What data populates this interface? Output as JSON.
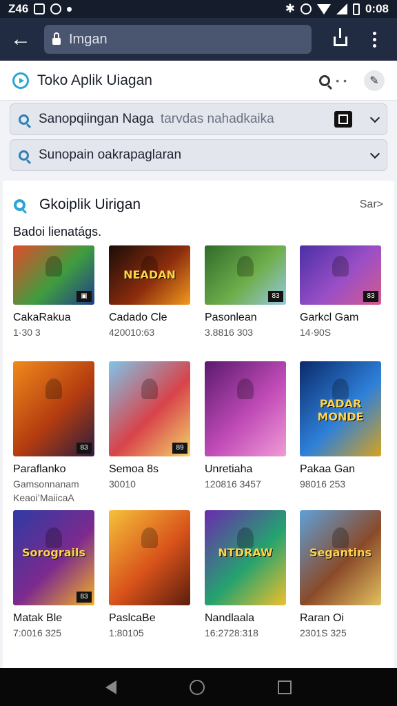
{
  "status_bar": {
    "left_text": "Z46",
    "time": "0:08"
  },
  "url_bar": {
    "url": "Imgan"
  },
  "header": {
    "title": "Toko Aplik Uiagan"
  },
  "search": {
    "primary": {
      "text": "Sanopqiingan Naga",
      "secondary": "tarvdas nahadkaika"
    },
    "secondary": {
      "text": "Sunopain oakrapaglaran"
    }
  },
  "section": {
    "title": "Gkoiplik Uirigan",
    "see_all": "Sar",
    "subtitle": "Badoi lienatágs."
  },
  "games": [
    {
      "name": "CakaRakua",
      "meta": "1·30 3",
      "thumb_text": "",
      "badge": "▣",
      "colors": [
        "#e14b2b",
        "#3f9d3f",
        "#203d8c"
      ]
    },
    {
      "name": "Cadado Cle",
      "meta": "420010:63",
      "thumb_text": "NEADAN",
      "badge": "",
      "colors": [
        "#1a0d08",
        "#8b2c0d",
        "#f29a1e"
      ]
    },
    {
      "name": "Pasonlean",
      "meta": "3.8816 303",
      "thumb_text": "",
      "badge": "83",
      "colors": [
        "#2f6b2a",
        "#6fae4b",
        "#96c8e0"
      ]
    },
    {
      "name": "Garkcl Gam",
      "meta": "14·90S",
      "thumb_text": "",
      "badge": "83",
      "colors": [
        "#4a2fa7",
        "#9b4fc6",
        "#d45b8c"
      ]
    },
    {
      "name": "Paraflanko",
      "meta": "Gamsonnanam",
      "meta2": "Keaoi’MaiicaA",
      "thumb_text": "",
      "badge": "83",
      "colors": [
        "#f08a1c",
        "#b43c10",
        "#2d1d3d"
      ]
    },
    {
      "name": "Semoa 8s",
      "meta": "30010",
      "thumb_text": "",
      "badge": "89",
      "colors": [
        "#7fc4e8",
        "#d8434a",
        "#f3d36b"
      ]
    },
    {
      "name": "Unretiaha",
      "meta": "120816 3457",
      "thumb_text": "",
      "badge": "",
      "colors": [
        "#5a1a6e",
        "#c04bb7",
        "#f19bd6"
      ]
    },
    {
      "name": "Pakaa Gan",
      "meta": "98016 253",
      "thumb_text": "PADAR MONDE",
      "badge": "",
      "colors": [
        "#0b2a6b",
        "#2e80d9",
        "#d7a21f"
      ]
    },
    {
      "name": "Matak Ble",
      "meta": "7:0016 325",
      "thumb_text": "Sorograils",
      "badge": "83",
      "colors": [
        "#2d3ba3",
        "#7d2a8e",
        "#f3b225"
      ]
    },
    {
      "name": "PaslcaBe",
      "meta": "1:80105",
      "thumb_text": "",
      "badge": "",
      "colors": [
        "#f6c13a",
        "#d8521a",
        "#5a1d0e"
      ]
    },
    {
      "name": "Nandlaala",
      "meta": "16:2728:318",
      "thumb_text": "NTDRAW",
      "badge": "",
      "colors": [
        "#6b2bb0",
        "#24a26f",
        "#f0c02b"
      ]
    },
    {
      "name": "Raran Oi",
      "meta": "2301S 325",
      "thumb_text": "Segantins",
      "badge": "",
      "colors": [
        "#5ea1d8",
        "#8a4a2a",
        "#e3c160"
      ]
    }
  ]
}
